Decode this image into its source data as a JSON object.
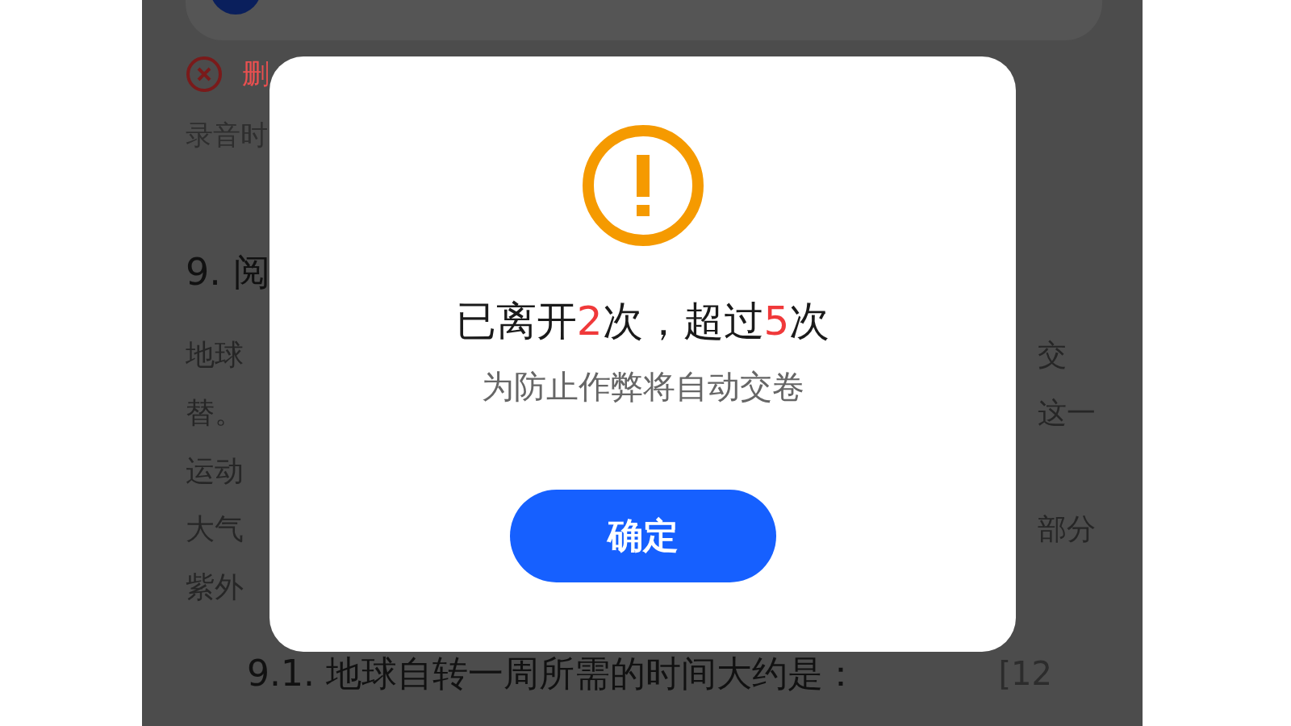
{
  "background": {
    "delete_label": "删",
    "recording_label": "录音时",
    "section_heading": "9. 阅",
    "paragraph_lines": [
      {
        "left": "地球",
        "right": "交"
      },
      {
        "left": "替。",
        "right": "这一"
      },
      {
        "left": "运动"
      },
      {
        "left": "大气",
        "right": "部分"
      },
      {
        "left": "紫外"
      }
    ],
    "question": "9.1. 地球自转一周所需的时间大约是：",
    "question_score": "[12"
  },
  "dialog": {
    "title": [
      {
        "text": "已离开",
        "highlight": false
      },
      {
        "text": "2",
        "highlight": true
      },
      {
        "text": "次，超过",
        "highlight": false
      },
      {
        "text": "5",
        "highlight": true
      },
      {
        "text": "次",
        "highlight": false
      }
    ],
    "message": "为防止作弊将自动交卷",
    "confirm_button": "确定"
  }
}
